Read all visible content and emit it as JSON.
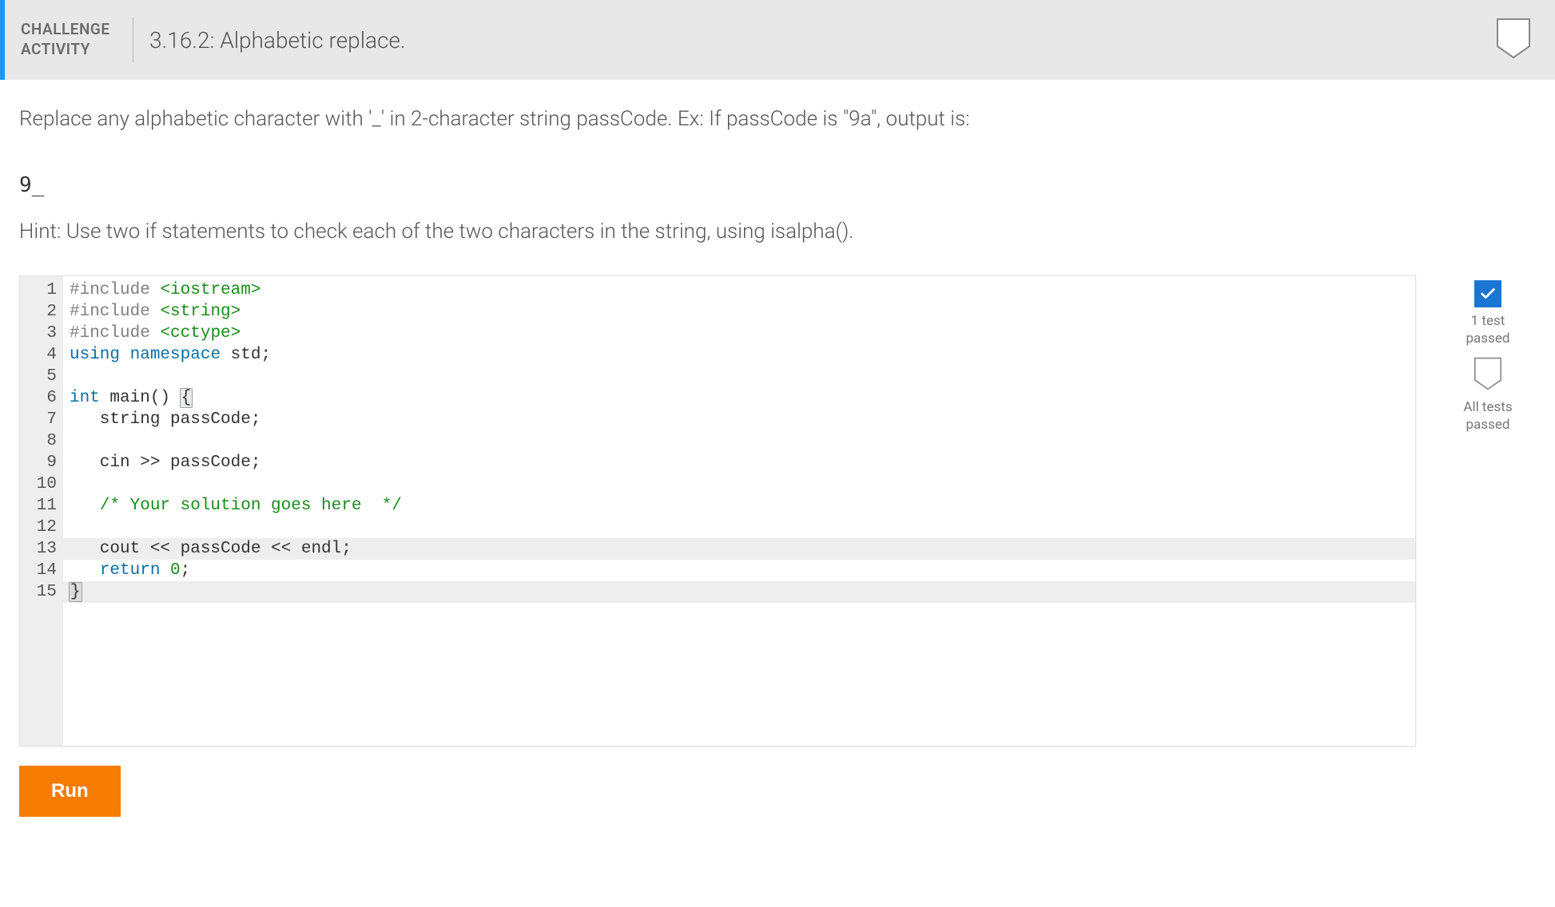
{
  "header": {
    "label_line1": "CHALLENGE",
    "label_line2": "ACTIVITY",
    "title": "3.16.2: Alphabetic replace."
  },
  "instructions": {
    "text": "Replace any alphabetic character with '_' in 2-character string passCode. Ex: If passCode is \"9a\", output is:",
    "example_output": "9_",
    "hint": "Hint: Use two if statements to check each of the two characters in the string, using isalpha()."
  },
  "code": {
    "lines": [
      {
        "n": 1,
        "tokens": [
          {
            "t": "#include",
            "c": "pp"
          },
          {
            "t": " "
          },
          {
            "t": "<iostream>",
            "c": "hdr"
          }
        ]
      },
      {
        "n": 2,
        "tokens": [
          {
            "t": "#include",
            "c": "pp"
          },
          {
            "t": " "
          },
          {
            "t": "<string>",
            "c": "hdr"
          }
        ]
      },
      {
        "n": 3,
        "tokens": [
          {
            "t": "#include",
            "c": "pp"
          },
          {
            "t": " "
          },
          {
            "t": "<cctype>",
            "c": "hdr"
          }
        ]
      },
      {
        "n": 4,
        "tokens": [
          {
            "t": "using",
            "c": "kw"
          },
          {
            "t": " "
          },
          {
            "t": "namespace",
            "c": "kw"
          },
          {
            "t": " std;"
          }
        ]
      },
      {
        "n": 5,
        "tokens": []
      },
      {
        "n": 6,
        "tokens": [
          {
            "t": "int",
            "c": "kw"
          },
          {
            "t": " main() "
          },
          {
            "t": "{",
            "c": "bracket-hl"
          }
        ]
      },
      {
        "n": 7,
        "tokens": [
          {
            "t": "   string passCode;"
          }
        ]
      },
      {
        "n": 8,
        "tokens": []
      },
      {
        "n": 9,
        "tokens": [
          {
            "t": "   cin >> passCode;"
          }
        ]
      },
      {
        "n": 10,
        "tokens": []
      },
      {
        "n": 11,
        "tokens": [
          {
            "t": "   "
          },
          {
            "t": "/* Your solution goes here  */",
            "c": "cmt"
          }
        ]
      },
      {
        "n": 12,
        "tokens": []
      },
      {
        "n": 13,
        "hl": true,
        "tokens": [
          {
            "t": "   cout << passCode << endl;"
          }
        ]
      },
      {
        "n": 14,
        "tokens": [
          {
            "t": "   "
          },
          {
            "t": "return",
            "c": "kw"
          },
          {
            "t": " "
          },
          {
            "t": "0",
            "c": "num"
          },
          {
            "t": ";"
          }
        ]
      },
      {
        "n": 15,
        "hl": true,
        "tokens": [
          {
            "t": "}",
            "c": "bracket-hl"
          }
        ]
      }
    ]
  },
  "status": {
    "passed_label_line1": "1 test",
    "passed_label_line2": "passed",
    "all_label_line1": "All tests",
    "all_label_line2": "passed"
  },
  "buttons": {
    "run": "Run"
  }
}
